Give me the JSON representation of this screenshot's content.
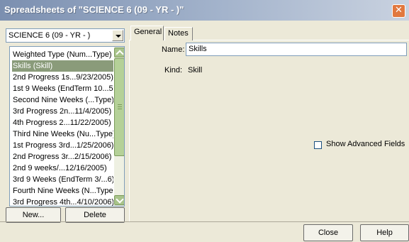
{
  "window": {
    "title": "Spreadsheets of \"SCIENCE 6 (09 - YR - )\""
  },
  "class_select": {
    "value": "SCIENCE 6 (09 - YR - )"
  },
  "spreadsheet_list": {
    "items": [
      "Weighted Type (Num...Type)",
      "Skills (Skill)",
      "2nd Progress 1s...9/23/2005)",
      "1st 9 Weeks (EndTerm 10...5)",
      "Second Nine Weeks (...Type)",
      "3rd Progress 2n...11/4/2005)",
      "4th Progress 2...11/22/2005)",
      "Third Nine Weeks (Nu...Type)",
      "1st Progress 3rd...1/25/2006)",
      "2nd Progress 3r...2/15/2006)",
      "2nd 9 weeks/...12/16/2005)",
      "3rd 9 Weeks (EndTerm 3/...6)",
      "Fourth Nine Weeks (N...Type)",
      "3rd Progress 4th...4/10/2006)"
    ],
    "selected_index": 1
  },
  "buttons": {
    "new": "New...",
    "delete": "Delete",
    "close": "Close",
    "help": "Help"
  },
  "tabs": [
    {
      "label": "General"
    },
    {
      "label": "Notes"
    }
  ],
  "general": {
    "name_label": "Name:",
    "name_value": "Skills",
    "kind_label": "Kind:",
    "kind_value": "Skill",
    "show_advanced_label": "Show Advanced Fields",
    "show_advanced_checked": false
  },
  "colors": {
    "selection": "#8a9b7a",
    "scrollbar": "#a9c48b",
    "close_button": "#e1783f"
  }
}
